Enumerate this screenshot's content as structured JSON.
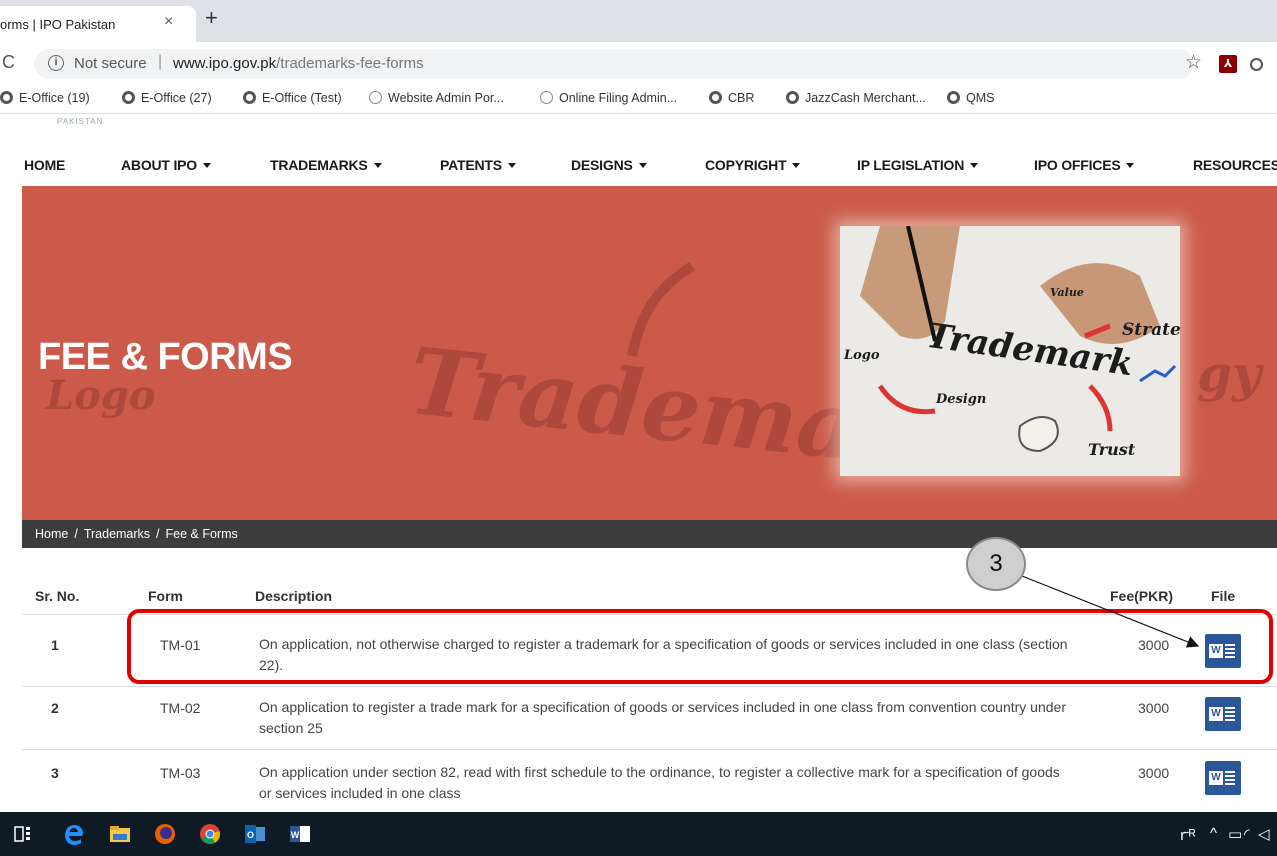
{
  "browser": {
    "tab_title": "orms | IPO Pakistan",
    "tab_close": "×",
    "new_tab": "+",
    "reload": "C",
    "not_secure": "Not secure",
    "separator": "|",
    "url_host": "www.ipo.gov.pk",
    "url_path": "/trademarks-fee-forms",
    "bookmarks": [
      {
        "label": "E-Office (19)",
        "icon": "globe-icon"
      },
      {
        "label": "E-Office (27)",
        "icon": "globe-icon"
      },
      {
        "label": "E-Office (Test)",
        "icon": "globe-icon"
      },
      {
        "label": "Website Admin Por...",
        "icon": "ie-icon"
      },
      {
        "label": "Online Filing Admin...",
        "icon": "ie-icon"
      },
      {
        "label": "CBR",
        "icon": "globe-icon"
      },
      {
        "label": "JazzCash Merchant...",
        "icon": "globe-icon"
      },
      {
        "label": "QMS",
        "icon": "globe-icon"
      }
    ]
  },
  "site": {
    "logo_text": "PAKISTAN",
    "nav": [
      {
        "label": "HOME",
        "has_dropdown": false
      },
      {
        "label": "ABOUT IPO",
        "has_dropdown": true
      },
      {
        "label": "TRADEMARKS",
        "has_dropdown": true
      },
      {
        "label": "PATENTS",
        "has_dropdown": true
      },
      {
        "label": "DESIGNS",
        "has_dropdown": true
      },
      {
        "label": "COPYRIGHT",
        "has_dropdown": true
      },
      {
        "label": "IP LEGISLATION",
        "has_dropdown": true
      },
      {
        "label": "IPO OFFICES",
        "has_dropdown": true
      },
      {
        "label": "RESOURCES",
        "has_dropdown": false
      }
    ],
    "hero": {
      "title": "FEE & FORMS",
      "bg_words": [
        "Trademark",
        "Logo",
        "gy"
      ],
      "photo_words": [
        "Trademark",
        "Strateg",
        "Value",
        "Logo",
        "Design",
        "Trust"
      ],
      "accent_color": "#cb5a4b"
    },
    "breadcrumb": [
      "Home",
      "Trademarks",
      "Fee & Forms"
    ],
    "breadcrumb_sep": "/",
    "table": {
      "headers": [
        "Sr. No.",
        "Form",
        "Description",
        "Fee(PKR)",
        "File"
      ],
      "rows": [
        {
          "sr": "1",
          "form": "TM-01",
          "description": "On application, not otherwise charged to register a trademark for a specification of goods or services included in one class (section 22).",
          "fee": "3000",
          "file": "word-file-icon"
        },
        {
          "sr": "2",
          "form": "TM-02",
          "description": "On application to register a trade mark for a specification of goods or services included in one class from convention country under section 25",
          "fee": "3000",
          "file": "word-file-icon"
        },
        {
          "sr": "3",
          "form": "TM-03",
          "description": "On application under section 82, read with first schedule to the ordinance, to register a collective mark for a specification of goods or services included in one class",
          "fee": "3000",
          "file": "word-file-icon"
        }
      ]
    }
  },
  "annotation": {
    "step_number": "3",
    "highlight_color": "#e00000"
  },
  "taskbar": {
    "tray_text": "ᴿ^"
  }
}
